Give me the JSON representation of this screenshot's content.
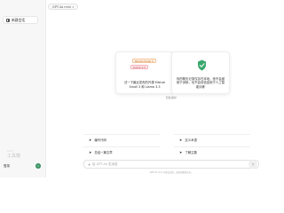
{
  "sidebar": {
    "new_chat_label": "新建会话",
    "brand_line1": "GPT ...",
    "brand_line2": "工具箱",
    "login_label": "登录"
  },
  "header": {
    "model_label": "GPT-4o mini"
  },
  "cards": {
    "left": {
      "tag1": "Mistral Small 3",
      "tag2": "Llama 3.3",
      "caption": "试一下最近发布的开源 Mistral Small 3 和 Llama 3.3"
    },
    "right": {
      "caption": "你的聊天记录仅存在本地，绝不会被用于训练，也不会将信息用于人工智能训练"
    },
    "pager": "隐私保护"
  },
  "suggestions": [
    {
      "label": "编写代码"
    },
    {
      "label": "定义术语"
    },
    {
      "label": "总结一篇文章"
    },
    {
      "label": "了解主题"
    }
  ],
  "composer": {
    "placeholder": "给 GPT-4o 发消息",
    "footer": "GPT-4o mini 可能会出错，请核查重要信息。"
  },
  "colors": {
    "sidebar_bg": "#f7f7f8",
    "accent_green": "#2e8b57"
  }
}
